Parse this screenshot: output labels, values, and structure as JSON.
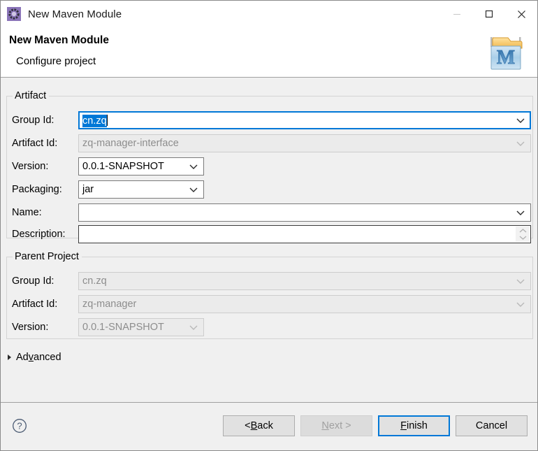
{
  "window": {
    "title": "New Maven Module",
    "icon": "maven-module-icon",
    "controls": {
      "minimize": "minimize-icon",
      "maximize": "maximize-icon",
      "close": "close-icon",
      "minimize_disabled": true
    }
  },
  "header": {
    "title": "New Maven Module",
    "subtitle": "Configure project",
    "logo": "maven-folder-logo"
  },
  "artifact": {
    "legend": "Artifact",
    "fields": [
      {
        "label": "Group Id:",
        "value": "cn.zq",
        "type": "combo",
        "state": "focused-selected",
        "name": "artifact-group-id"
      },
      {
        "label": "Artifact Id:",
        "value": "zq-manager-interface",
        "type": "combo",
        "state": "disabled",
        "name": "artifact-artifact-id"
      },
      {
        "label": "Version:",
        "value": "0.0.1-SNAPSHOT",
        "type": "combo",
        "state": "enabled",
        "name": "artifact-version"
      },
      {
        "label": "Packaging:",
        "value": "jar",
        "type": "combo",
        "state": "enabled",
        "name": "artifact-packaging"
      },
      {
        "label": "Name:",
        "value": "",
        "type": "combo",
        "state": "enabled",
        "name": "artifact-name"
      },
      {
        "label": "Description:",
        "value": "",
        "type": "textarea",
        "state": "enabled",
        "name": "artifact-description"
      }
    ]
  },
  "parent": {
    "legend": "Parent Project",
    "fields": [
      {
        "label": "Group Id:",
        "value": "cn.zq",
        "type": "combo",
        "state": "disabled",
        "name": "parent-group-id"
      },
      {
        "label": "Artifact Id:",
        "value": "zq-manager",
        "type": "combo",
        "state": "disabled",
        "name": "parent-artifact-id"
      },
      {
        "label": "Version:",
        "value": "0.0.1-SNAPSHOT",
        "type": "combo",
        "state": "disabled",
        "name": "parent-version"
      }
    ]
  },
  "advanced": {
    "label_before": "Ad",
    "label_mnemonic": "v",
    "label_after": "anced",
    "expanded": false
  },
  "footer": {
    "help": "help-icon",
    "buttons": [
      {
        "before": "< ",
        "mnemonic": "B",
        "after": "ack",
        "state": "enabled",
        "name": "back-button"
      },
      {
        "before": "",
        "mnemonic": "N",
        "after": "ext >",
        "state": "disabled",
        "name": "next-button"
      },
      {
        "before": "",
        "mnemonic": "F",
        "after": "inish",
        "state": "default",
        "name": "finish-button"
      },
      {
        "before": "Cancel",
        "mnemonic": "",
        "after": "",
        "state": "enabled",
        "name": "cancel-button"
      }
    ]
  },
  "colors": {
    "accent": "#0078d7",
    "window_bg": "#f0f0f0",
    "header_bg": "#ffffff",
    "selection": "#0078d7",
    "disabled_text": "#8d8d8d"
  }
}
